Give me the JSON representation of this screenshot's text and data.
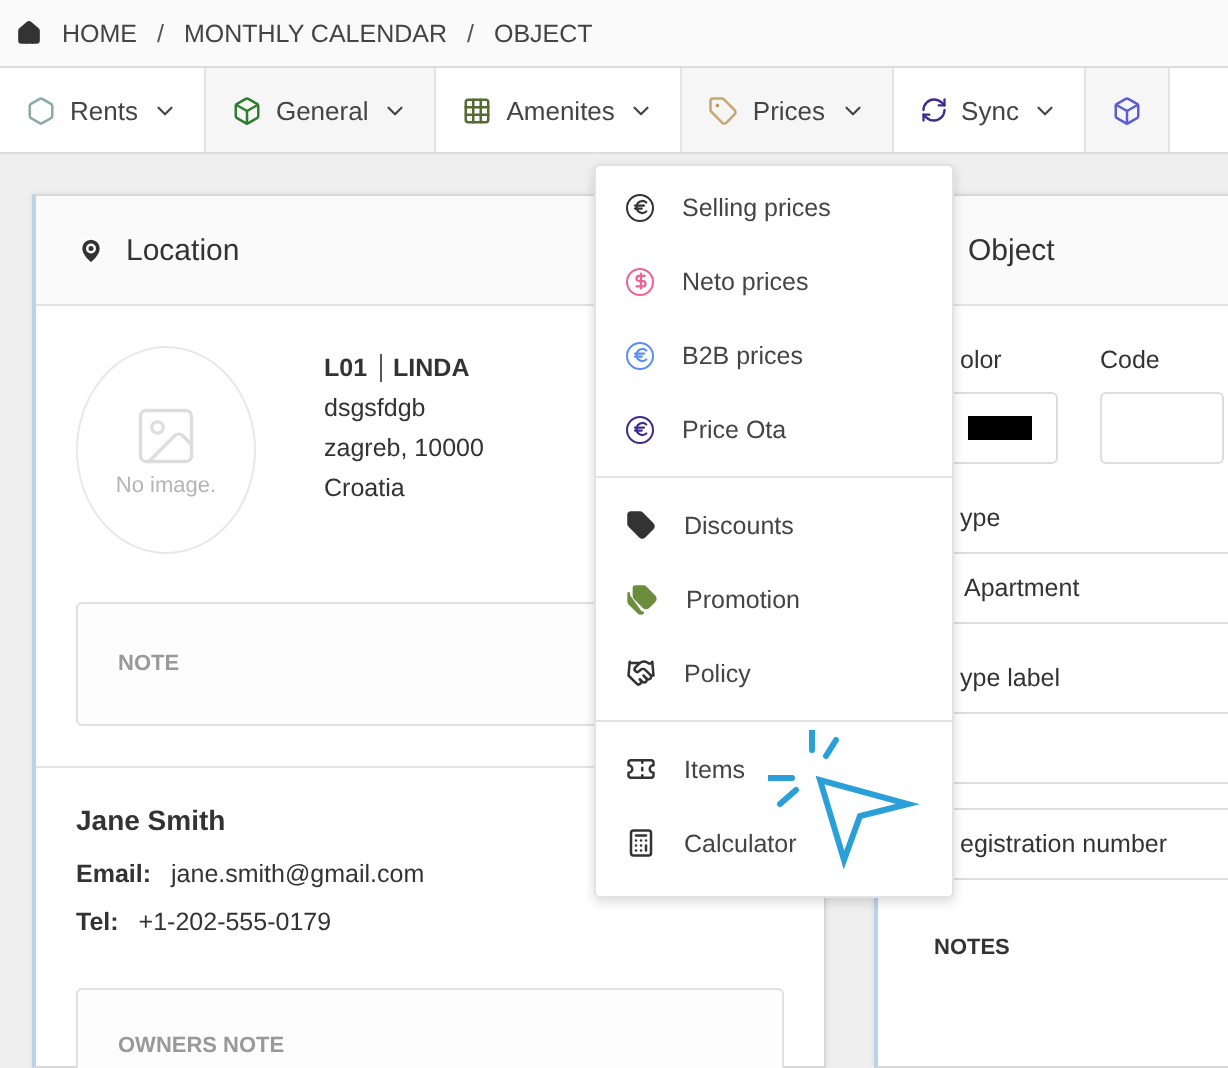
{
  "breadcrumb": [
    "HOME",
    "MONTHLY CALENDAR",
    "OBJECT"
  ],
  "breadcrumb_separator": "/",
  "tabs": [
    {
      "label": "Rents"
    },
    {
      "label": "General"
    },
    {
      "label": "Amenites"
    },
    {
      "label": "Prices"
    },
    {
      "label": "Sync"
    }
  ],
  "location": {
    "title": "Location",
    "no_image_label": "No image.",
    "code": "L01",
    "name": "LINDA",
    "address_lines": [
      "dsgsfdgb",
      "zagreb, 10000",
      "Croatia"
    ],
    "note_label": "NOTE",
    "owner": {
      "name": "Jane Smith",
      "email_label": "Email:",
      "email": "jane.smith@gmail.com",
      "tel_label": "Tel:",
      "tel": "+1-202-555-0179"
    },
    "owners_note_label": "OWNERS NOTE"
  },
  "object": {
    "title": "Object",
    "color_label": "olor",
    "code_label": "Code",
    "type_label": "ype",
    "type_value": "Apartment",
    "type_label_label": "ype label",
    "registration_label": "egistration number",
    "notes_label": "NOTES"
  },
  "menu": {
    "groups": [
      [
        "Selling prices",
        "Neto prices",
        "B2B prices",
        "Price Ota"
      ],
      [
        "Discounts",
        "Promotion",
        "Policy"
      ],
      [
        "Items",
        "Calculator"
      ]
    ]
  }
}
